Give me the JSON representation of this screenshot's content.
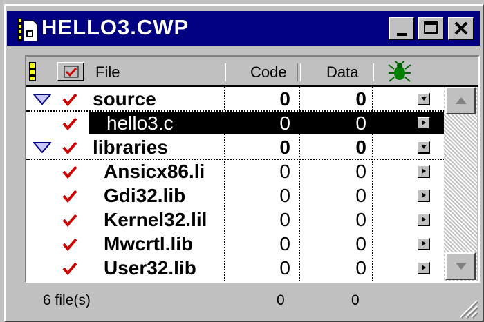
{
  "window": {
    "title": "HELLO3.CWP",
    "minimize_icon": "minimize-icon",
    "maximize_icon": "maximize-icon",
    "close_icon": "close-icon"
  },
  "header": {
    "file_label": "File",
    "code_label": "Code",
    "data_label": "Data",
    "debug_icon": "bug-icon"
  },
  "rows": [
    {
      "name": "source",
      "code": "0",
      "data": "0",
      "group": true,
      "expanded": true,
      "selected": false
    },
    {
      "name": "hello3.c",
      "code": "0",
      "data": "0",
      "group": false,
      "selected": true
    },
    {
      "name": "libraries",
      "code": "0",
      "data": "0",
      "group": true,
      "expanded": true,
      "selected": false
    },
    {
      "name": "Ansicx86.li",
      "code": "0",
      "data": "0",
      "group": false,
      "selected": false
    },
    {
      "name": "Gdi32.lib",
      "code": "0",
      "data": "0",
      "group": false,
      "selected": false
    },
    {
      "name": "Kernel32.lil",
      "code": "0",
      "data": "0",
      "group": false,
      "selected": false
    },
    {
      "name": "Mwcrtl.lib",
      "code": "0",
      "data": "0",
      "group": false,
      "selected": false
    },
    {
      "name": "User32.lib",
      "code": "0",
      "data": "0",
      "group": false,
      "selected": false
    }
  ],
  "status": {
    "files": "6 file(s)",
    "code_total": "0",
    "data_total": "0"
  },
  "colors": {
    "titlebar": "#000080",
    "check": "#d00000",
    "selection": "#000000"
  }
}
